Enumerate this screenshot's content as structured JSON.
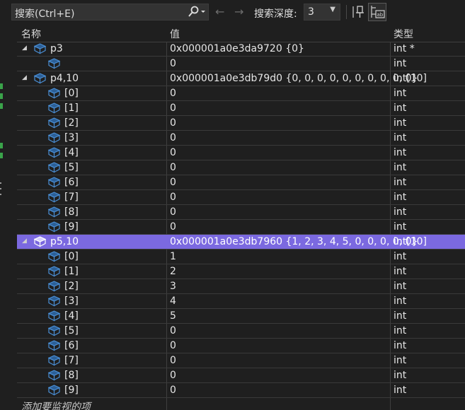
{
  "toolbar": {
    "search_label": "搜索(Ctrl+E)",
    "depth_label": "搜索深度:",
    "depth_value": "3"
  },
  "columns": {
    "name": "名称",
    "value": "值",
    "type": "类型"
  },
  "rows": [
    {
      "name": "p3",
      "value": "0x000001a0e3da9720 {0}",
      "type": "int *",
      "level": 0,
      "expanded": true,
      "selected": false
    },
    {
      "name": "",
      "value": "0",
      "type": "int",
      "level": 1,
      "expanded": null,
      "selected": false
    },
    {
      "name": "p4,10",
      "value": "0x000001a0e3db79d0 {0, 0, 0, 0, 0, 0, 0, 0, 0, 0}",
      "type": "int[10]",
      "level": 0,
      "expanded": true,
      "selected": false
    },
    {
      "name": "[0]",
      "value": "0",
      "type": "int",
      "level": 1,
      "expanded": null,
      "selected": false
    },
    {
      "name": "[1]",
      "value": "0",
      "type": "int",
      "level": 1,
      "expanded": null,
      "selected": false
    },
    {
      "name": "[2]",
      "value": "0",
      "type": "int",
      "level": 1,
      "expanded": null,
      "selected": false
    },
    {
      "name": "[3]",
      "value": "0",
      "type": "int",
      "level": 1,
      "expanded": null,
      "selected": false
    },
    {
      "name": "[4]",
      "value": "0",
      "type": "int",
      "level": 1,
      "expanded": null,
      "selected": false
    },
    {
      "name": "[5]",
      "value": "0",
      "type": "int",
      "level": 1,
      "expanded": null,
      "selected": false
    },
    {
      "name": "[6]",
      "value": "0",
      "type": "int",
      "level": 1,
      "expanded": null,
      "selected": false
    },
    {
      "name": "[7]",
      "value": "0",
      "type": "int",
      "level": 1,
      "expanded": null,
      "selected": false
    },
    {
      "name": "[8]",
      "value": "0",
      "type": "int",
      "level": 1,
      "expanded": null,
      "selected": false
    },
    {
      "name": "[9]",
      "value": "0",
      "type": "int",
      "level": 1,
      "expanded": null,
      "selected": false
    },
    {
      "name": "p5,10",
      "value": "0x000001a0e3db7960 {1, 2, 3, 4, 5, 0, 0, 0, 0, 0}",
      "type": "int[10]",
      "level": 0,
      "expanded": true,
      "selected": true
    },
    {
      "name": "[0]",
      "value": "1",
      "type": "int",
      "level": 1,
      "expanded": null,
      "selected": false
    },
    {
      "name": "[1]",
      "value": "2",
      "type": "int",
      "level": 1,
      "expanded": null,
      "selected": false
    },
    {
      "name": "[2]",
      "value": "3",
      "type": "int",
      "level": 1,
      "expanded": null,
      "selected": false
    },
    {
      "name": "[3]",
      "value": "4",
      "type": "int",
      "level": 1,
      "expanded": null,
      "selected": false
    },
    {
      "name": "[4]",
      "value": "5",
      "type": "int",
      "level": 1,
      "expanded": null,
      "selected": false
    },
    {
      "name": "[5]",
      "value": "0",
      "type": "int",
      "level": 1,
      "expanded": null,
      "selected": false
    },
    {
      "name": "[6]",
      "value": "0",
      "type": "int",
      "level": 1,
      "expanded": null,
      "selected": false
    },
    {
      "name": "[7]",
      "value": "0",
      "type": "int",
      "level": 1,
      "expanded": null,
      "selected": false
    },
    {
      "name": "[8]",
      "value": "0",
      "type": "int",
      "level": 1,
      "expanded": null,
      "selected": false
    },
    {
      "name": "[9]",
      "value": "0",
      "type": "int",
      "level": 1,
      "expanded": null,
      "selected": false
    }
  ],
  "add_item_text": "添加要监视的项",
  "colors": {
    "background": "#1f1f1f",
    "selection": "#7b69e0",
    "icon_blue": "#4a8fd6",
    "gutter_green": "#3aa34a"
  }
}
